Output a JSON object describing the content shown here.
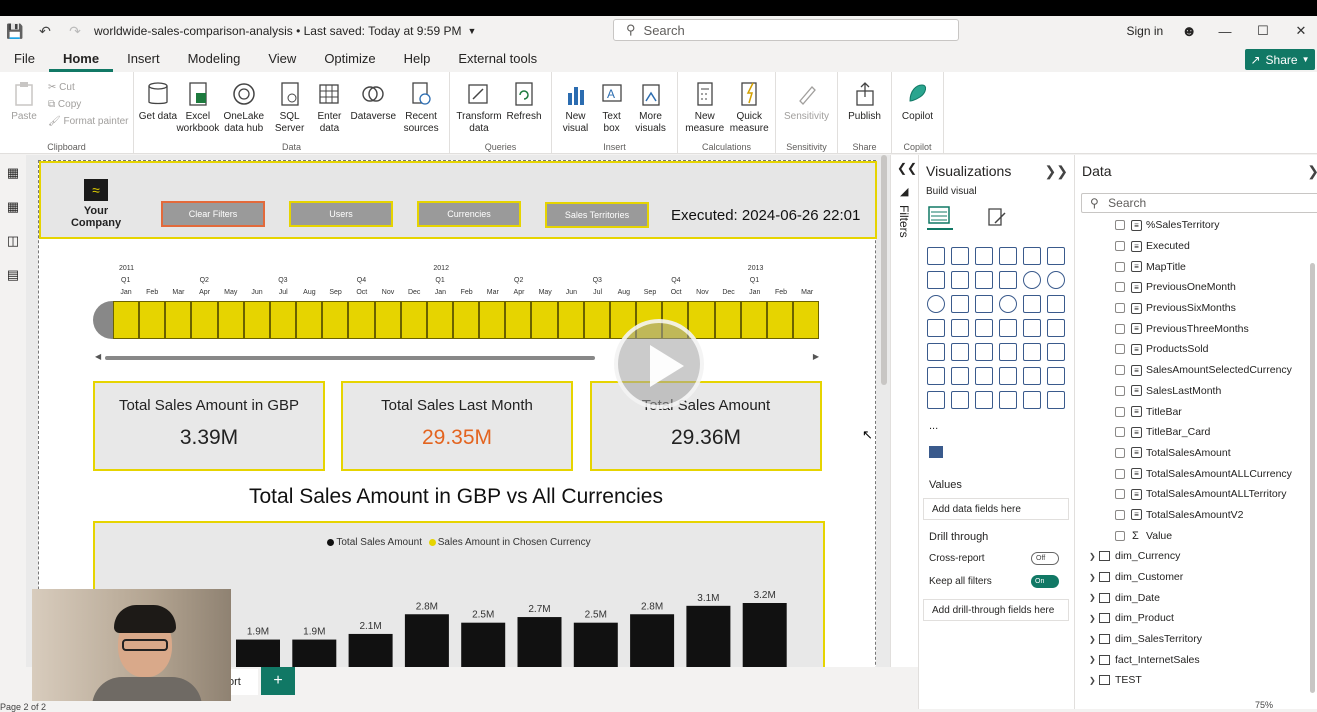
{
  "titlebar": {
    "doc_title": "worldwide-sales-comparison-analysis • Last saved: Today at 9:59 PM",
    "search_placeholder": "Search",
    "sign_in": "Sign in"
  },
  "menu": {
    "items": [
      "File",
      "Home",
      "Insert",
      "Modeling",
      "View",
      "Optimize",
      "Help",
      "External tools"
    ],
    "active": "Home",
    "share_label": "Share"
  },
  "ribbon": {
    "clipboard": {
      "paste": "Paste",
      "cut": "Cut",
      "copy": "Copy",
      "format_painter": "Format painter",
      "label": "Clipboard"
    },
    "data": {
      "buttons": [
        "Get data",
        "Excel workbook",
        "OneLake data hub",
        "SQL Server",
        "Enter data",
        "Dataverse",
        "Recent sources"
      ],
      "label": "Data"
    },
    "queries": {
      "buttons": [
        "Transform data",
        "Refresh"
      ],
      "label": "Queries"
    },
    "insert": {
      "buttons": [
        "New visual",
        "Text box",
        "More visuals"
      ],
      "label": "Insert"
    },
    "calculations": {
      "buttons": [
        "New measure",
        "Quick measure"
      ],
      "label": "Calculations"
    },
    "sensitivity": {
      "buttons": [
        "Sensitivity"
      ],
      "label": "Sensitivity"
    },
    "share": {
      "buttons": [
        "Publish"
      ],
      "label": "Share"
    },
    "copilot": {
      "buttons": [
        "Copilot"
      ],
      "label": "Copilot"
    }
  },
  "report": {
    "company": "Your Company",
    "buttons": {
      "clear": "Clear Filters",
      "users": "Users",
      "currencies": "Currencies",
      "territories": "Sales Territories"
    },
    "executed": "Executed: 2024-06-26 22:01",
    "timeline": {
      "years": [
        "2011",
        "2012",
        "2013"
      ],
      "quarters": [
        "Q1",
        "Q2",
        "Q3",
        "Q4",
        "Q1",
        "Q2",
        "Q3",
        "Q4",
        "Q1"
      ],
      "months": [
        "Jan",
        "Feb",
        "Mar",
        "Apr",
        "May",
        "Jun",
        "Jul",
        "Aug",
        "Sep",
        "Oct",
        "Nov",
        "Dec",
        "Jan",
        "Feb",
        "Mar",
        "Apr",
        "May",
        "Jun",
        "Jul",
        "Aug",
        "Sep",
        "Oct",
        "Nov",
        "Dec",
        "Jan",
        "Feb",
        "Mar"
      ]
    },
    "cards": [
      {
        "title": "Total Sales Amount in GBP",
        "value": "3.39M"
      },
      {
        "title": "Total Sales Last Month",
        "value": "29.35M"
      },
      {
        "title": "Total Sales Amount",
        "value": "29.36M"
      }
    ],
    "accent": "#e6d400",
    "highlight": "#e3641f",
    "chart_title": "Total Sales Amount in GBP vs All Currencies",
    "page_tab": "ort"
  },
  "chart_data": {
    "type": "bar",
    "title": "Total Sales Amount in GBP vs All Currencies",
    "legend": [
      "Total Sales Amount",
      "Sales Amount in Chosen Currency"
    ],
    "legend_colors": [
      "#111111",
      "#e6d400"
    ],
    "series": [
      {
        "name": "Total Sales Amount",
        "values": [
          1.9,
          1.9,
          2.1,
          2.8,
          2.5,
          2.7,
          2.5,
          2.8,
          3.1,
          3.2
        ]
      }
    ],
    "data_labels": [
      "1.9M",
      "1.9M",
      "2.1M",
      "2.8M",
      "2.5M",
      "2.7M",
      "2.5M",
      "2.8M",
      "3.1M",
      "3.2M"
    ],
    "ylim": [
      0,
      3.2
    ]
  },
  "viz_pane": {
    "title": "Visualizations",
    "build_visual": "Build visual",
    "more": "...",
    "values_label": "Values",
    "add_data_fields": "Add data fields here",
    "drill_through": "Drill through",
    "cross_report": "Cross-report",
    "cross_report_state": "Off",
    "keep_all_filters": "Keep all filters",
    "keep_all_filters_state": "On",
    "add_drill_fields": "Add drill-through fields here",
    "filters_label": "Filters"
  },
  "data_pane": {
    "title": "Data",
    "search_placeholder": "Search",
    "measures": [
      "%SalesTerritory",
      "Executed",
      "MapTitle",
      "PreviousOneMonth",
      "PreviousSixMonths",
      "PreviousThreeMonths",
      "ProductsSold",
      "SalesAmountSelectedCurrency",
      "SalesLastMonth",
      "TitleBar",
      "TitleBar_Card",
      "TotalSalesAmount",
      "TotalSalesAmountALLCurrency",
      "TotalSalesAmountALLTerritory",
      "TotalSalesAmountV2"
    ],
    "value_field": "Value",
    "tables": [
      "dim_Currency",
      "dim_Customer",
      "dim_Date",
      "dim_Product",
      "dim_SalesTerritory",
      "fact_InternetSales",
      "TEST"
    ]
  },
  "status": {
    "page": "Page 2 of 2",
    "zoom": "75%"
  }
}
